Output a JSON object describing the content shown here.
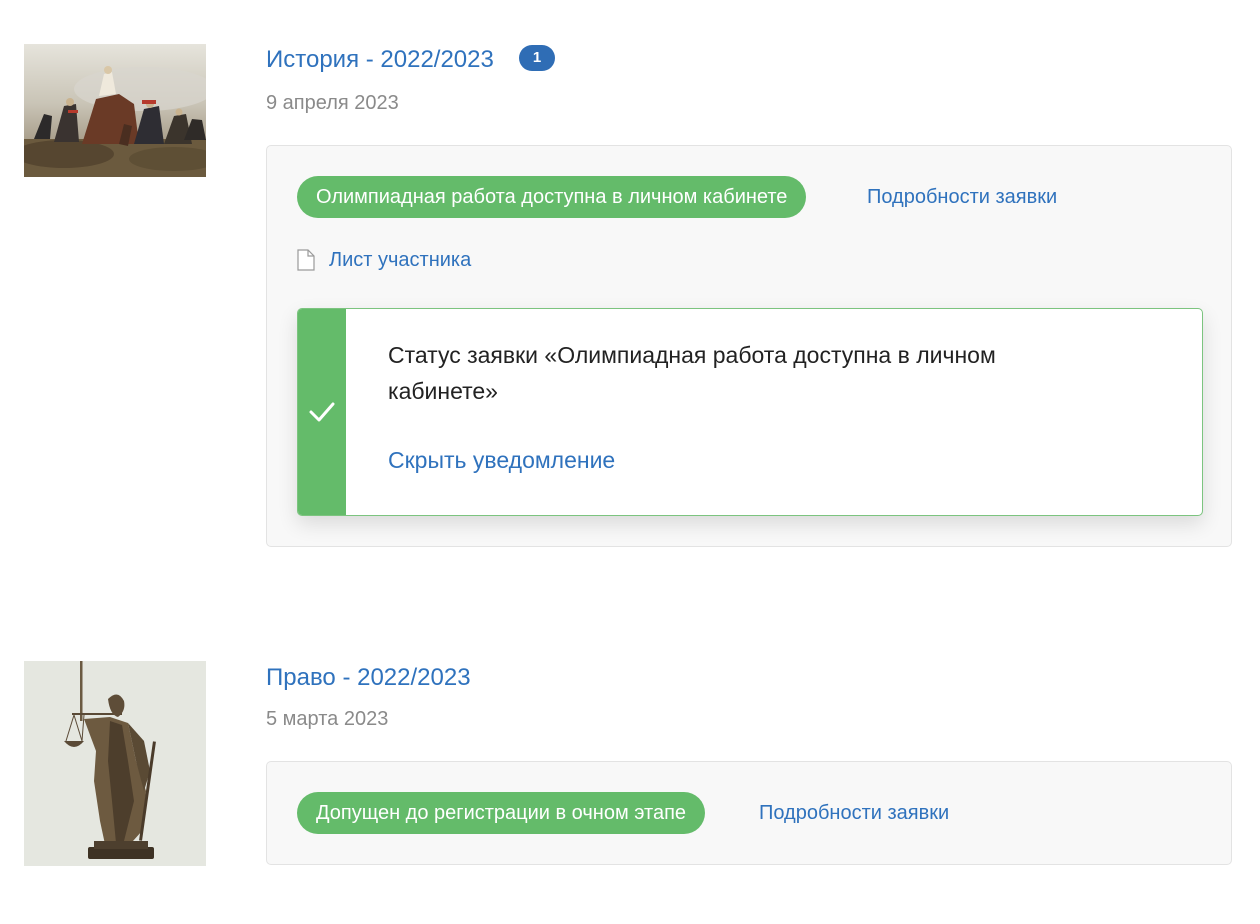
{
  "entries": [
    {
      "title": "История - 2022/2023",
      "badge": "1",
      "date": "9 апреля 2023",
      "status": "Олимпиадная работа доступна в личном кабинете",
      "details_link": "Подробности заявки",
      "document_link": "Лист участника",
      "notification": {
        "text": "Статус заявки «Олимпиадная работа доступна в личном кабинете»",
        "hide_link": "Скрыть уведомление"
      }
    },
    {
      "title": "Право - 2022/2023",
      "date": "5 марта 2023",
      "status": "Допущен до регистрации в очном этапе",
      "details_link": "Подробности заявки"
    }
  ],
  "colors": {
    "link": "#2f72bd",
    "status_green": "#64bb6a",
    "badge_blue": "#2f6db5",
    "date_gray": "#8a8a8a"
  },
  "icons": {
    "document": "document-icon",
    "check": "checkmark-icon"
  }
}
